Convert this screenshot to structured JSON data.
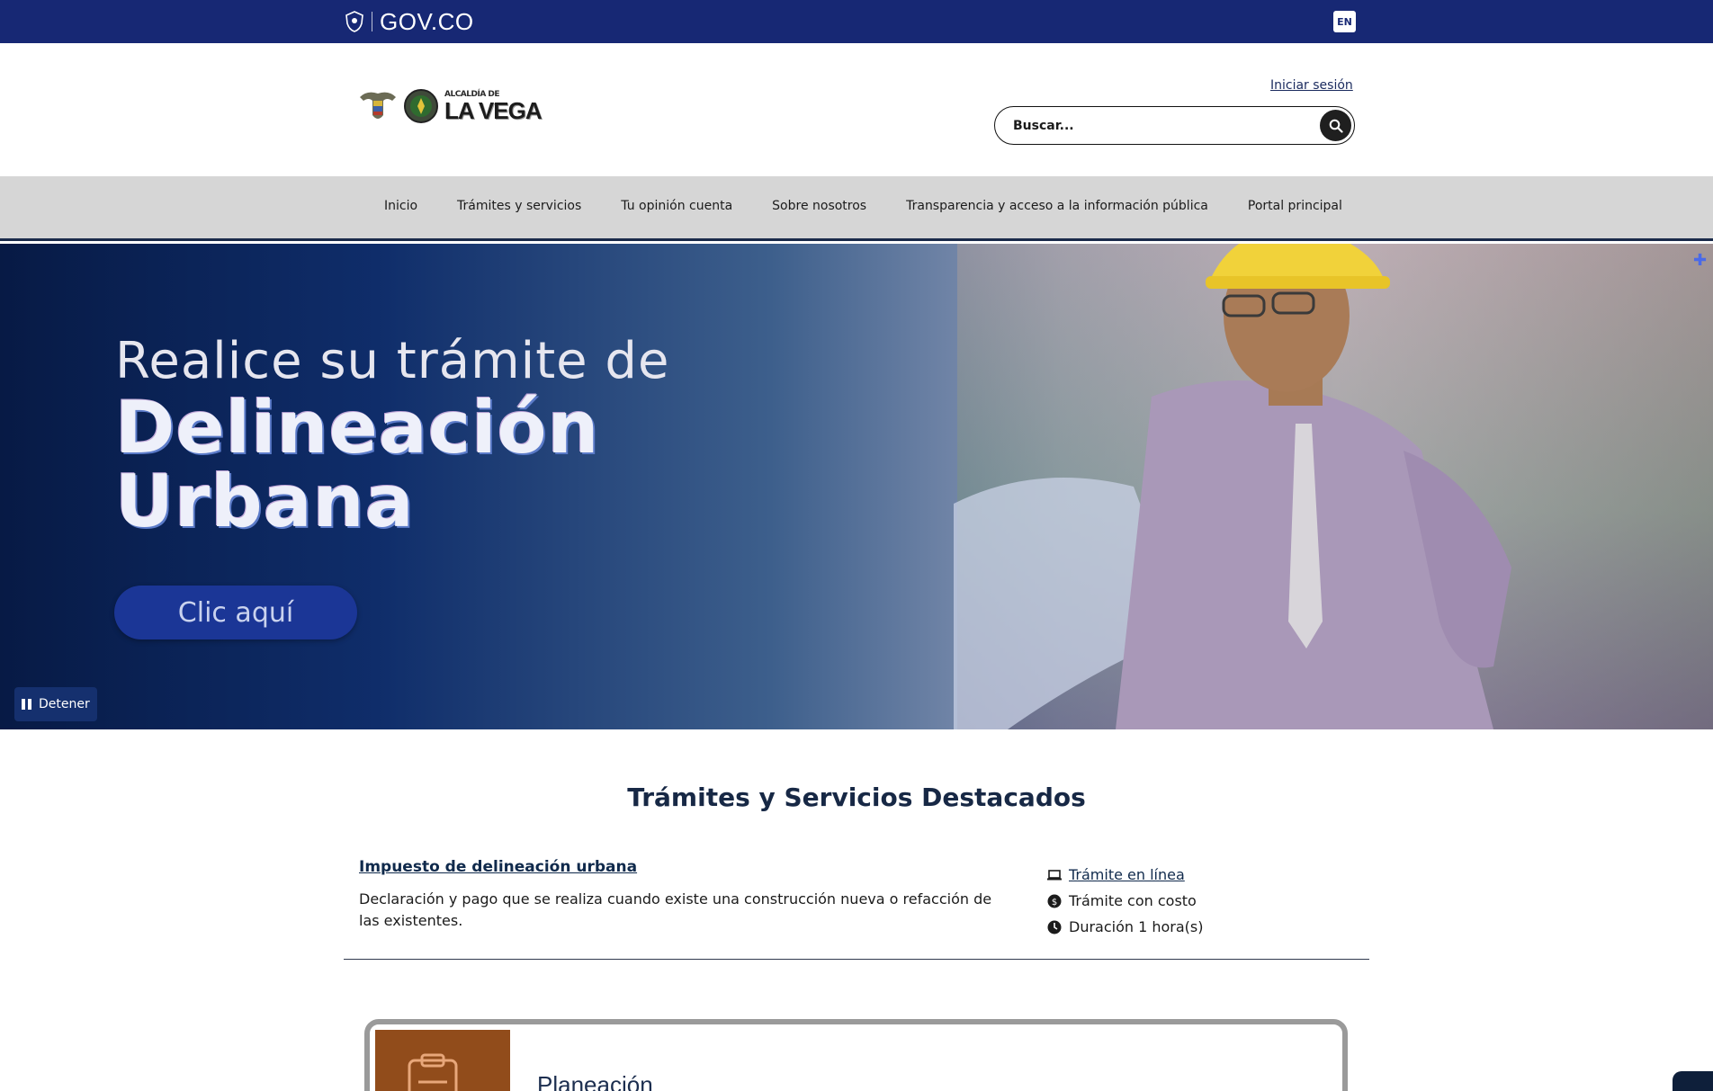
{
  "govbar": {
    "brand": "GOV.CO",
    "lang": "EN"
  },
  "header": {
    "logo_small": "ALCALDÍA DE",
    "logo_big": "LA VEGA",
    "login": "Iniciar sesión",
    "search_placeholder": "Buscar..."
  },
  "nav": {
    "items": [
      {
        "label": "Inicio"
      },
      {
        "label": "Trámites y servicios"
      },
      {
        "label": "Tu opinión cuenta"
      },
      {
        "label": "Sobre nosotros"
      },
      {
        "label": "Transparencia y acceso a la información pública"
      },
      {
        "label": "Portal principal"
      }
    ]
  },
  "hero": {
    "line1": "Realice su trámite de",
    "line2": "Delineación",
    "line3": "Urbana",
    "cta": "Clic aquí",
    "stop": "Detener"
  },
  "featured": {
    "title": "Trámites y Servicios Destacados",
    "item_title": "Impuesto de delineación urbana",
    "item_desc": "Declaración y pago que se realiza cuando existe una construcción nueva o refacción de las existentes.",
    "meta_online": "Trámite en línea",
    "meta_cost": "Trámite con costo",
    "meta_duration": "Duración 1 hora(s)"
  },
  "card": {
    "title": "Planeación"
  },
  "colors": {
    "govbar": "#172874",
    "nav": "#d6d6d6",
    "accent": "#1b3696",
    "card_thumb": "#914c1b"
  }
}
